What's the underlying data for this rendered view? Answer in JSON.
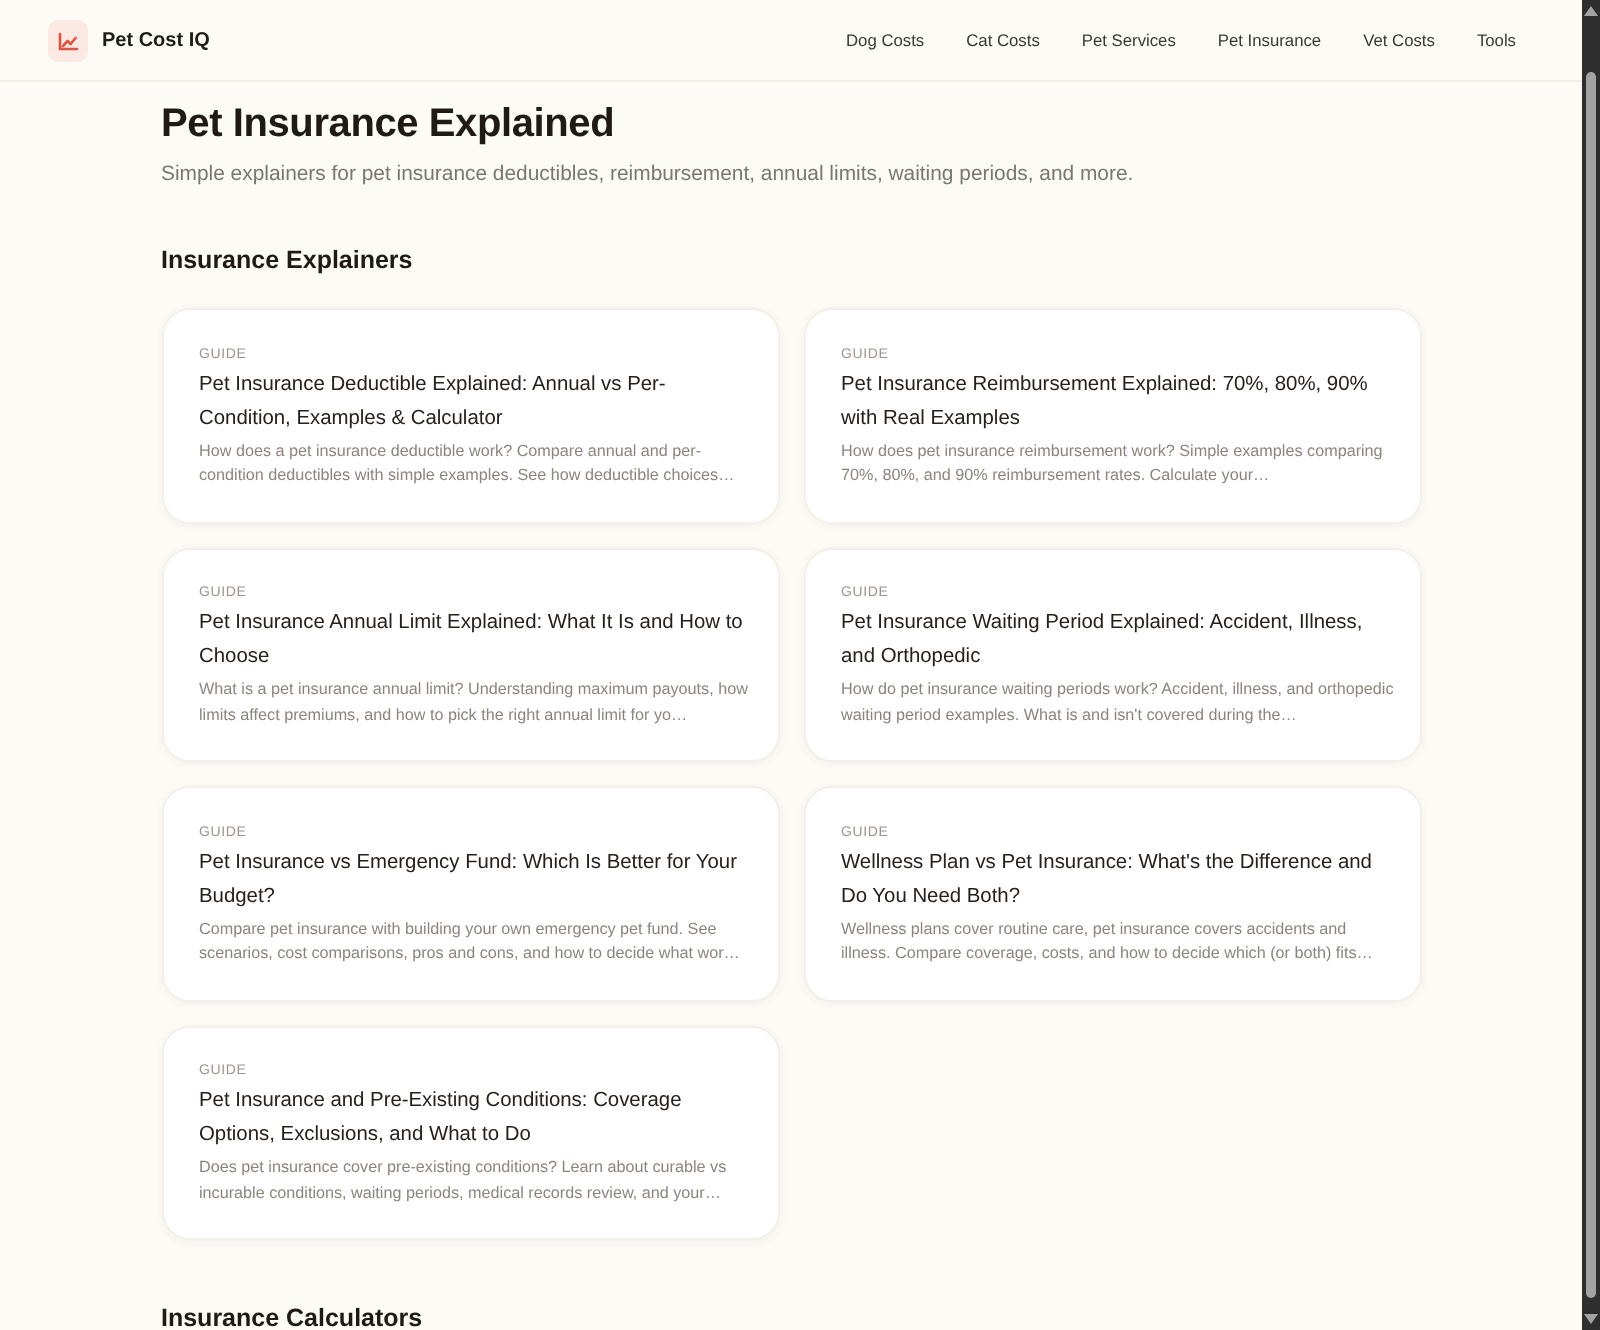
{
  "header": {
    "brand": "Pet Cost IQ",
    "nav": [
      "Dog Costs",
      "Cat Costs",
      "Pet Services",
      "Pet Insurance",
      "Vet Costs",
      "Tools"
    ]
  },
  "intro": {
    "title": "Pet Insurance Explained",
    "subtitle": "Simple explainers for pet insurance deductibles, reimbursement, annual limits, waiting periods, and more."
  },
  "sections": [
    {
      "heading": "Insurance Explainers",
      "cards": [
        {
          "tag": "GUIDE",
          "title": "Pet Insurance Deductible Explained: Annual vs Per-Condition, Examples & Calculator",
          "description": "How does a pet insurance deductible work? Compare annual and per-condition deductibles with simple examples. See how deductible choices…"
        },
        {
          "tag": "GUIDE",
          "title": "Pet Insurance Reimbursement Explained: 70%, 80%, 90% with Real Examples",
          "description": "How does pet insurance reimbursement work? Simple examples comparing 70%, 80%, and 90% reimbursement rates. Calculate your…"
        },
        {
          "tag": "GUIDE",
          "title": "Pet Insurance Annual Limit Explained: What It Is and How to Choose",
          "description": "What is a pet insurance annual limit? Understanding maximum payouts, how limits affect premiums, and how to pick the right annual limit for yo…"
        },
        {
          "tag": "GUIDE",
          "title": "Pet Insurance Waiting Period Explained: Accident, Illness, and Orthopedic",
          "description": "How do pet insurance waiting periods work? Accident, illness, and orthopedic waiting period examples. What is and isn't covered during the…"
        },
        {
          "tag": "GUIDE",
          "title": "Pet Insurance vs Emergency Fund: Which Is Better for Your Budget?",
          "description": "Compare pet insurance with building your own emergency pet fund. See scenarios, cost comparisons, pros and cons, and how to decide what wor…"
        },
        {
          "tag": "GUIDE",
          "title": "Wellness Plan vs Pet Insurance: What's the Difference and Do You Need Both?",
          "description": "Wellness plans cover routine care, pet insurance covers accidents and illness. Compare coverage, costs, and how to decide which (or both) fits…"
        },
        {
          "tag": "GUIDE",
          "title": "Pet Insurance and Pre-Existing Conditions: Coverage Options, Exclusions, and What to Do",
          "description": "Does pet insurance cover pre-existing conditions? Learn about curable vs incurable conditions, waiting periods, medical records review, and your…"
        }
      ]
    },
    {
      "heading": "Insurance Calculators"
    }
  ]
}
